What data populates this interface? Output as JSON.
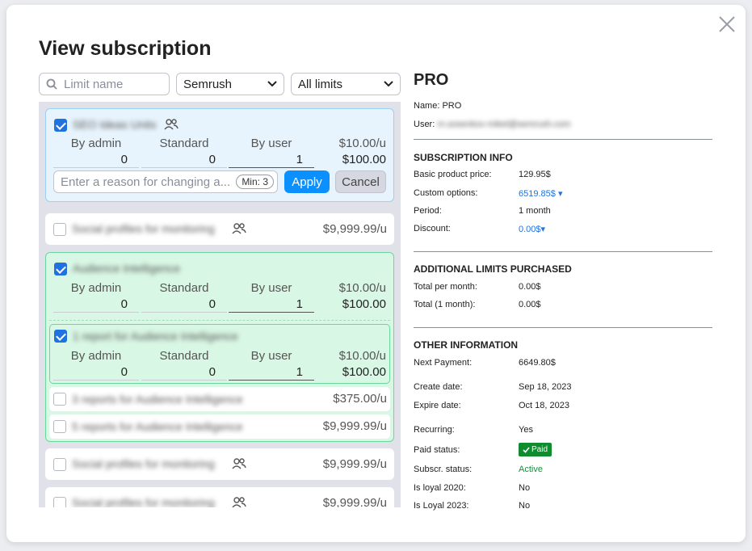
{
  "dialog": {
    "title": "View subscription"
  },
  "filters": {
    "search_placeholder": "Limit name",
    "product_select": "Semrush",
    "limit_select": "All limits"
  },
  "columns": {
    "by_admin": "By admin",
    "standard": "Standard",
    "by_user": "By user"
  },
  "reason": {
    "placeholder": "Enter a reason for changing a...",
    "min_label": "Min: 3",
    "apply_label": "Apply",
    "cancel_label": "Cancel"
  },
  "limits": [
    {
      "name": "SEO Ideas Units",
      "checked": true,
      "group": false,
      "price": "$10.00/u",
      "by_admin": "0",
      "standard": "0",
      "by_user": "1",
      "total": "$100.00"
    },
    {
      "name": "Social profiles for monitoring",
      "checked": false,
      "group": true,
      "price": "$9,999.99/u"
    },
    {
      "name": "Audience Intelligence",
      "checked": true,
      "group": false,
      "price": "$10.00/u",
      "by_admin": "0",
      "standard": "0",
      "by_user": "1",
      "total": "$100.00"
    },
    {
      "name": "1 report for Audience Intelligence",
      "checked": true,
      "group": false,
      "price": "$10.00/u",
      "by_admin": "0",
      "standard": "0",
      "by_user": "1",
      "total": "$100.00"
    },
    {
      "name": "3 reports for Audience Intelligence",
      "checked": false,
      "group": false,
      "price": "$375.00/u"
    },
    {
      "name": "5 reports for Audience Intelligence",
      "checked": false,
      "group": false,
      "price": "$9,999.99/u"
    },
    {
      "name": "Social profiles for monitoring",
      "checked": false,
      "group": true,
      "price": "$9,999.99/u"
    },
    {
      "name": "Social profiles for monitoring",
      "checked": false,
      "group": true,
      "price": "$9,999.99/u"
    }
  ],
  "plan": {
    "title": "PRO",
    "name_label": "Name:",
    "name_value": "PRO",
    "user_label": "User:",
    "user_value": "m.sosenkov-mikel@semrush.com"
  },
  "subscription_info": {
    "heading": "SUBSCRIPTION INFO",
    "rows": [
      {
        "label": "Basic product price:",
        "value": "129.95$"
      },
      {
        "label": "Custom options:",
        "value": "6519.85$"
      },
      {
        "label": "Period:",
        "value": "1 month"
      },
      {
        "label": "Discount:",
        "value": "0.00$"
      }
    ]
  },
  "additional_limits": {
    "heading": "ADDITIONAL LIMITS PURCHASED",
    "rows": [
      {
        "label": "Total per month:",
        "value": "0.00$"
      },
      {
        "label": "Total (1 month):",
        "value": "0.00$"
      }
    ]
  },
  "other_info": {
    "heading": "OTHER INFORMATION",
    "rows": [
      {
        "label": "Next Payment:",
        "value": "6649.80$"
      },
      {
        "label": "Create date:",
        "value": "Sep 18, 2023"
      },
      {
        "label": "Expire date:",
        "value": "Oct 18, 2023"
      },
      {
        "label": "Recurring:",
        "value": "Yes"
      },
      {
        "label": "Paid status:",
        "value": "Paid"
      },
      {
        "label": "Subscr. status:",
        "value": "Active"
      },
      {
        "label": "Is loyal 2020:",
        "value": "No"
      },
      {
        "label": "Is Loyal 2023:",
        "value": "No"
      }
    ]
  },
  "colors": {
    "primary": "#0b91ff",
    "link": "#1f73e0",
    "success": "#108b2e"
  }
}
